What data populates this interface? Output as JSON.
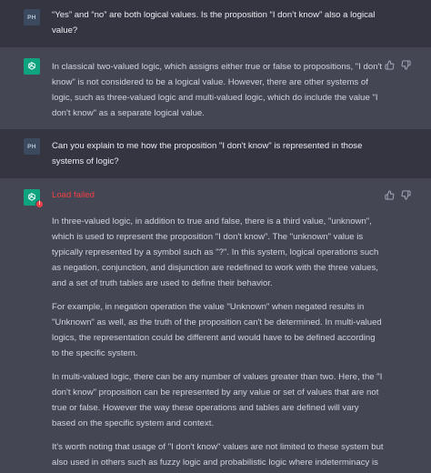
{
  "messages": [
    {
      "role": "user",
      "avatar_label": "PH",
      "text": "“Yes” and “no” are both logical values. Is the proposition “I don’t know” also a logical value?"
    },
    {
      "role": "assistant",
      "paragraphs": [
        "In classical two-valued logic, which assigns either true or false to propositions, \"I don't know\" is not considered to be a logical value. However, there are other systems of logic, such as three-valued logic and multi-valued logic, which do include the value \"I don't know\" as a separate logical value."
      ]
    },
    {
      "role": "user",
      "avatar_label": "PH",
      "text": "Can you explain to me how the proposition \"I don't know\" is represented in those systems of logic?"
    },
    {
      "role": "assistant",
      "status": "Load failed",
      "error_badge": "!",
      "paragraphs": [
        "In three-valued logic, in addition to true and false, there is a third value, \"unknown\", which is used to represent the proposition \"I don't know\". The \"unknown\" value is typically represented by a symbol such as \"?\". In this system, logical operations such as negation, conjunction, and disjunction are redefined to work with the three values, and a set of truth tables are used to define their behavior.",
        "For example, in negation operation the value \"Unknown\" when negated results in \"Unknown\" as well, as the truth of the proposition can't be determined. In multi-valued logics, the representation could be different and would have to be defined according to the specific system.",
        "In multi-valued logic, there can be any number of values greater than two. Here, the \"I don't know\" proposition can be represented by any value or set of values that are not true or false. However the way these operations and tables are defined will vary based on the specific system and context.",
        "It's worth noting that usage of \"I don't know\" values are not limited to these system but also used in others such as fuzzy logic and probabilistic logic where indeterminacy is represented by a degree of certainty."
      ]
    }
  ],
  "icons": {
    "user_avatar": "user-initials-avatar",
    "assistant_avatar": "openai-logo-icon",
    "thumbs_up": "thumbs-up-icon",
    "thumbs_down": "thumbs-down-icon",
    "error": "error-badge-icon"
  },
  "colors": {
    "user_bg": "#343541",
    "assistant_bg": "#444654",
    "brand_green": "#10a37f",
    "error_red": "#ef4146"
  }
}
